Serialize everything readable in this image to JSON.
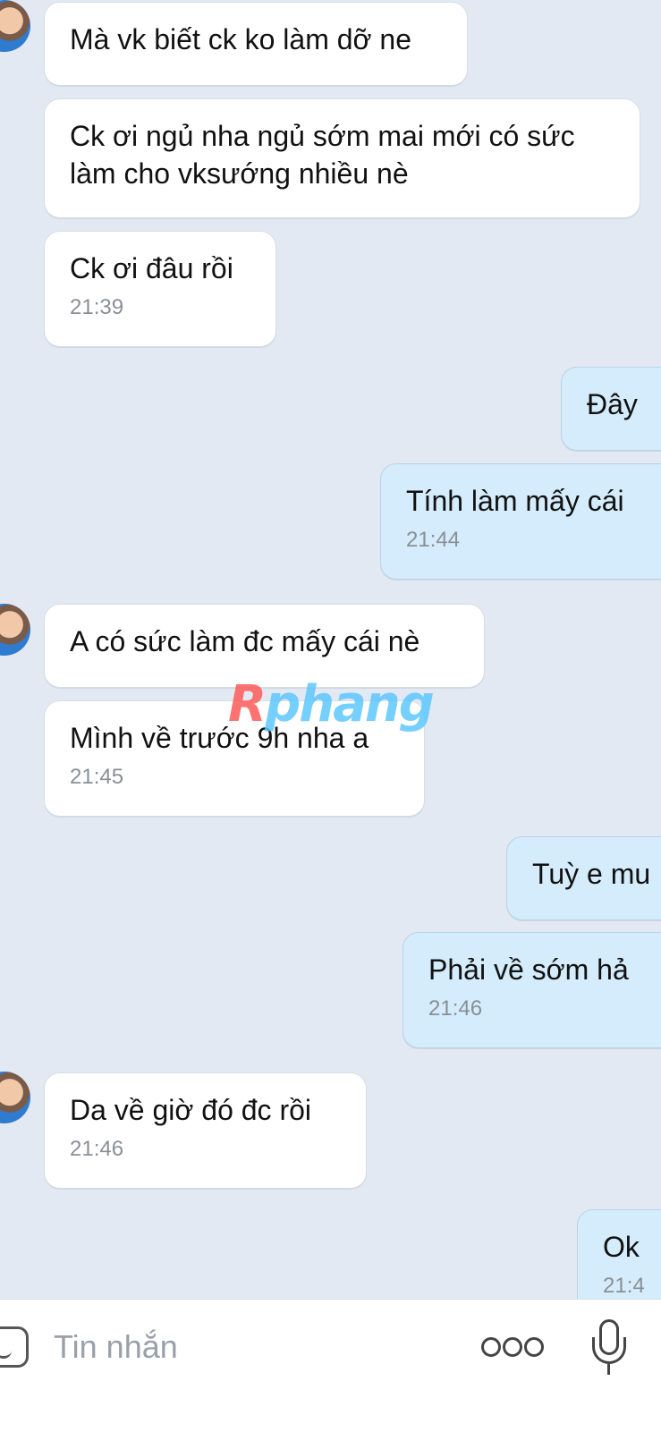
{
  "messages": [
    {
      "side": "in",
      "text": "Mà vk biết ck ko làm dỡ ne",
      "time": ""
    },
    {
      "side": "in",
      "text": "Ck ơi ngủ nha ngủ sớm mai mới có sức làm cho vksướng nhiều nè",
      "time": ""
    },
    {
      "side": "in",
      "text": "Ck ơi đâu rồi",
      "time": "21:39"
    },
    {
      "side": "out",
      "text": "Đây",
      "time": ""
    },
    {
      "side": "out",
      "text": "Tính làm mấy cái",
      "time": "21:44"
    },
    {
      "side": "in",
      "text": "A có sức làm đc mấy cái nè",
      "time": ""
    },
    {
      "side": "in",
      "text": "Mình về trước  9h nha a",
      "time": "21:45"
    },
    {
      "side": "out",
      "text": "Tuỳ e mu",
      "time": ""
    },
    {
      "side": "out",
      "text": "Phải về sớm hả",
      "time": "21:46"
    },
    {
      "side": "in",
      "text": "Da về giờ đó đc rồi",
      "time": "21:46"
    },
    {
      "side": "out",
      "text": "Ok",
      "time": "21:4"
    }
  ],
  "watermark": {
    "first": "R",
    "rest": "phang"
  },
  "composer": {
    "placeholder": "Tin nhắn",
    "icons": {
      "emoji": "emoji-icon",
      "more": "more-options-icon",
      "mic": "microphone-icon"
    }
  },
  "colors": {
    "incoming": "#ffffff",
    "outgoing": "#d4ecfb",
    "background": "#e2e9f2"
  }
}
